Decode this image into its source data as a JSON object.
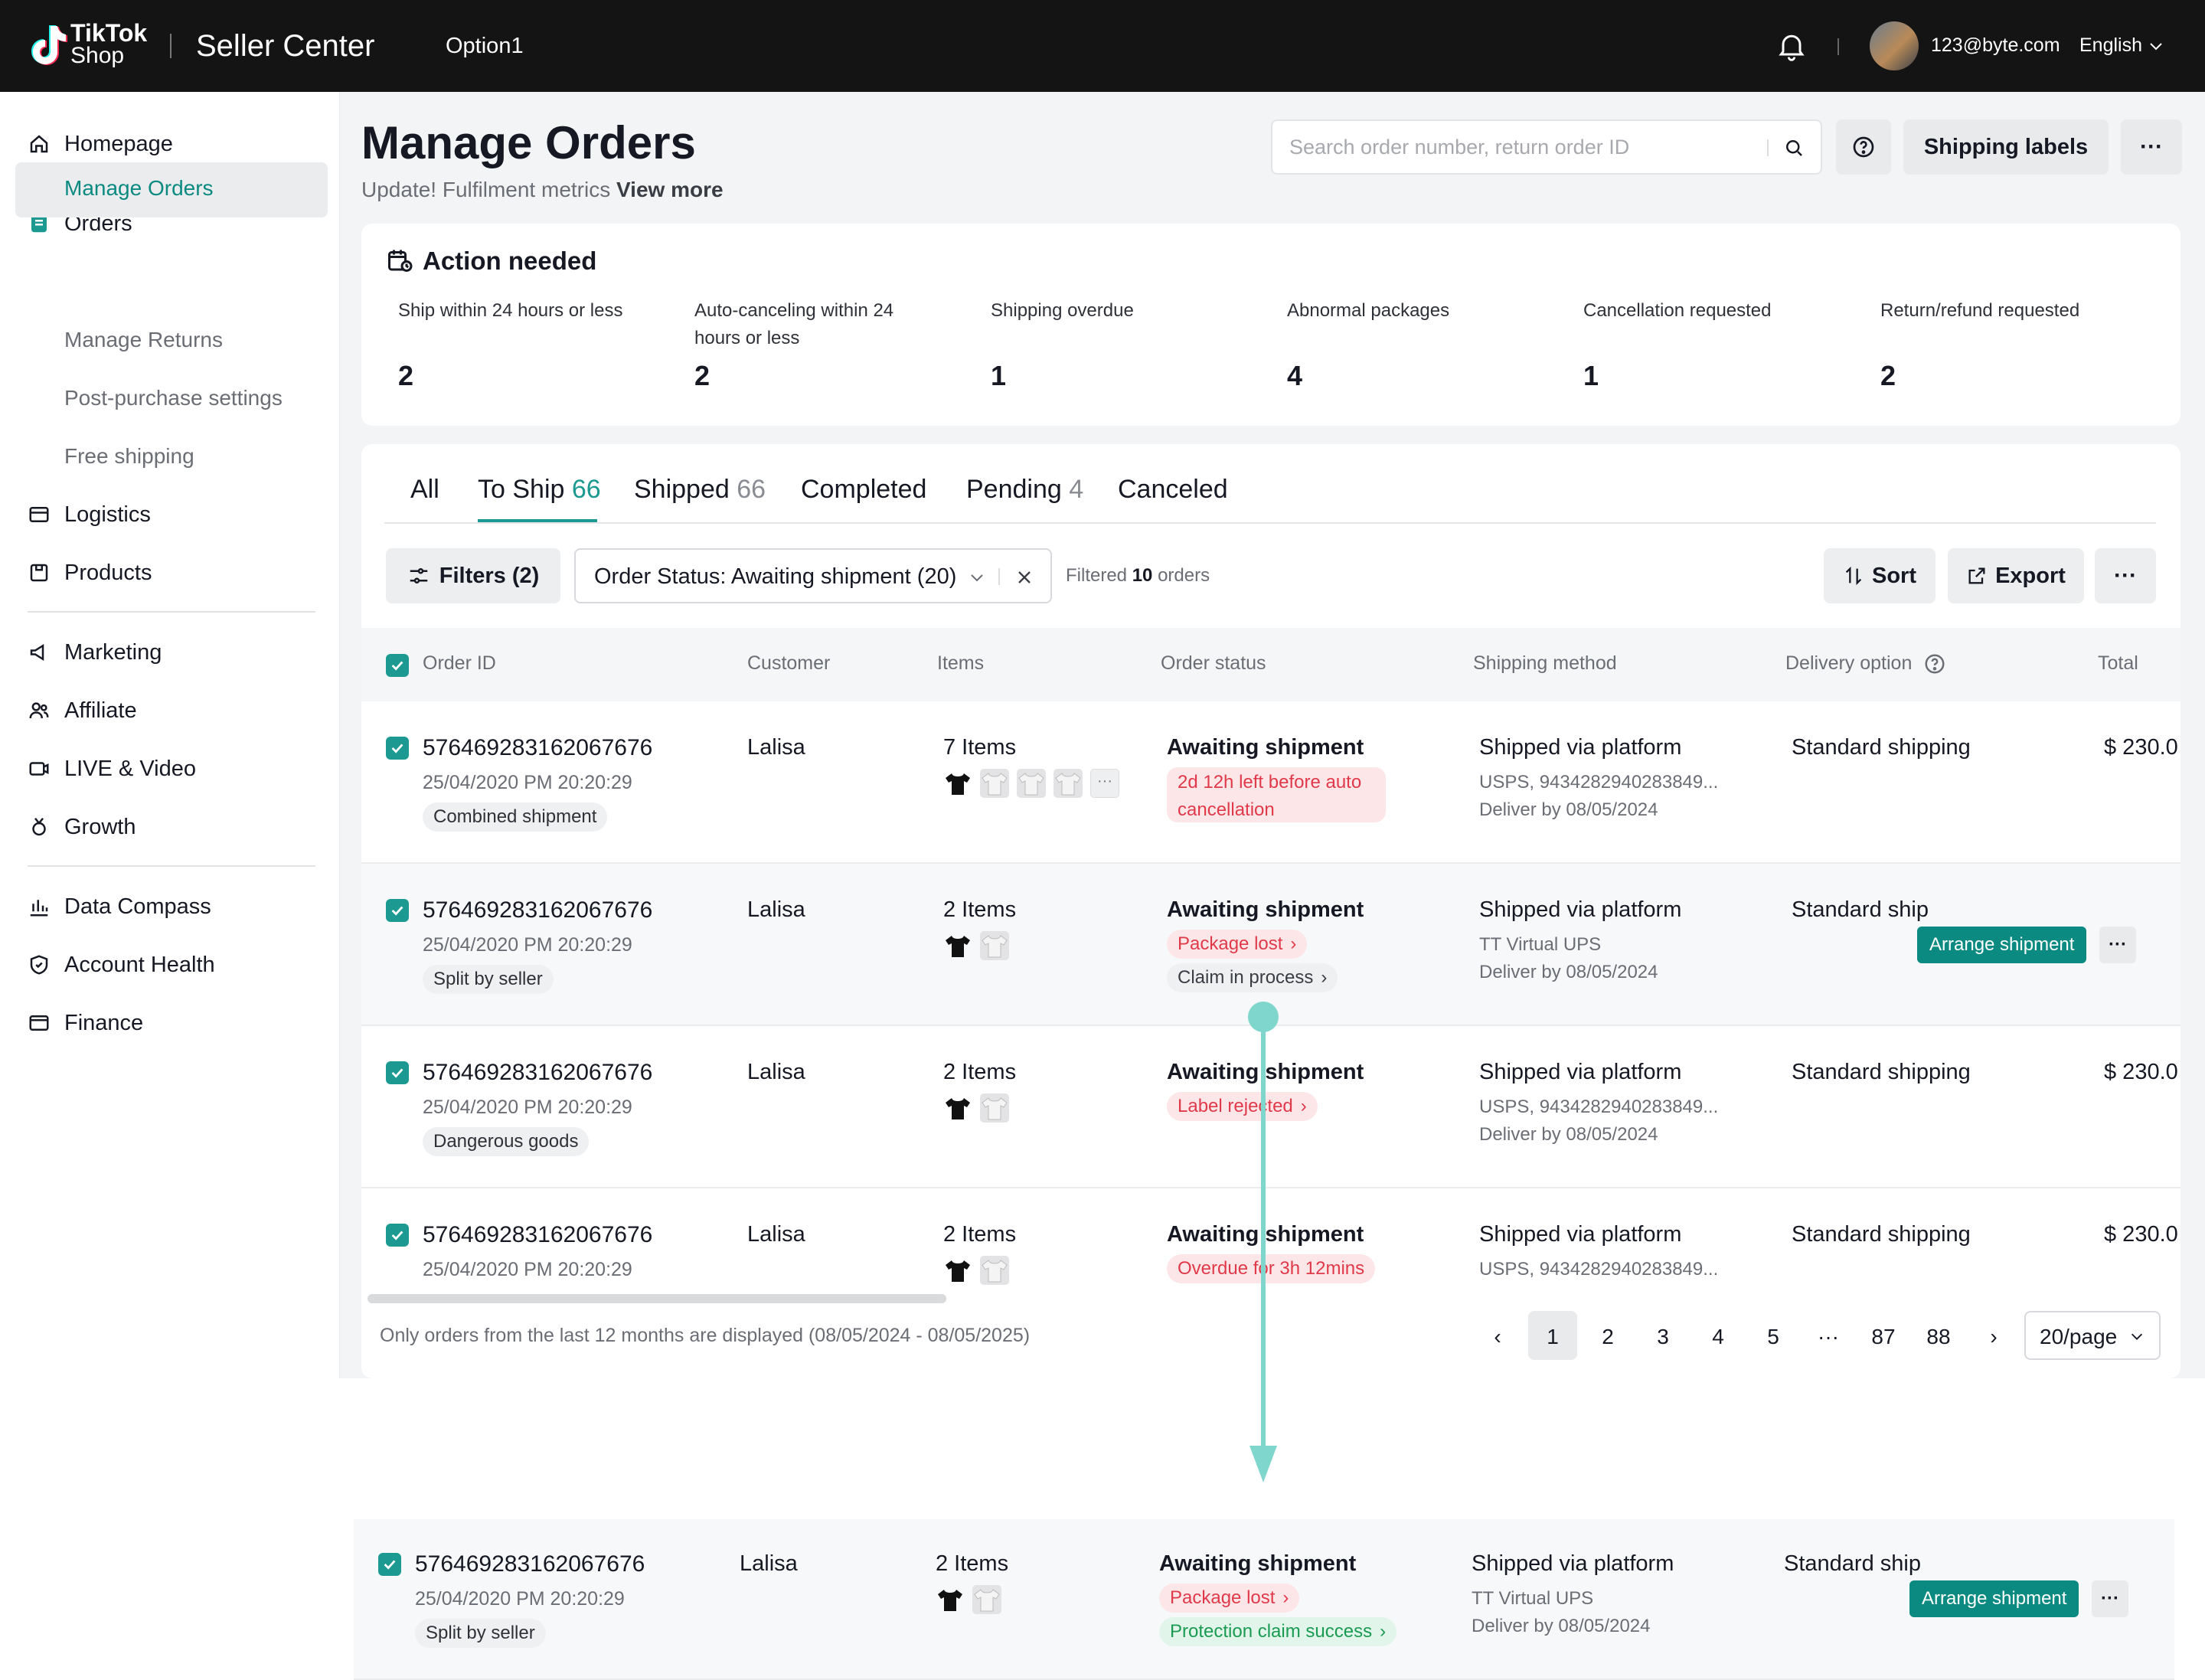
{
  "topbar": {
    "logo_line1": "TikTok",
    "logo_line2": "Shop",
    "app_name": "Seller Center",
    "option": "Option1",
    "email": "123@byte.com",
    "language": "English"
  },
  "sidebar": {
    "homepage": "Homepage",
    "orders": "Orders",
    "manage_orders": "Manage Orders",
    "manage_returns": "Manage Returns",
    "post_purchase": "Post-purchase settings",
    "free_shipping": "Free shipping",
    "logistics": "Logistics",
    "products": "Products",
    "marketing": "Marketing",
    "affiliate": "Affiliate",
    "live_video": "LIVE & Video",
    "growth": "Growth",
    "data_compass": "Data Compass",
    "account_health": "Account Health",
    "finance": "Finance"
  },
  "header": {
    "title": "Manage Orders",
    "subtitle": "Update! Fulfilment metrics",
    "subtitle_link": "View more",
    "search_placeholder": "Search order number, return order ID",
    "shipping_labels": "Shipping labels"
  },
  "action_needed": {
    "title": "Action needed",
    "items": [
      {
        "label": "Ship within 24 hours or less",
        "value": "2"
      },
      {
        "label": "Auto-canceling within 24 hours or less",
        "value": "2"
      },
      {
        "label": "Shipping overdue",
        "value": "1"
      },
      {
        "label": "Abnormal packages",
        "value": "4"
      },
      {
        "label": "Cancellation requested",
        "value": "1"
      },
      {
        "label": "Return/refund requested",
        "value": "2"
      }
    ]
  },
  "tabs": [
    {
      "label": "All",
      "count": ""
    },
    {
      "label": "To Ship",
      "count": "66"
    },
    {
      "label": "Shipped",
      "count": "66"
    },
    {
      "label": "Completed",
      "count": ""
    },
    {
      "label": "Pending",
      "count": "4"
    },
    {
      "label": "Canceled",
      "count": ""
    }
  ],
  "toolbar": {
    "filters": "Filters (2)",
    "status_filter": "Order Status: Awaiting shipment (20)",
    "filtered_prefix": "Filtered",
    "filtered_count": "10",
    "filtered_suffix": "orders",
    "sort": "Sort",
    "export": "Export"
  },
  "table": {
    "columns": [
      "Order ID",
      "Customer",
      "Items",
      "Order status",
      "Shipping method",
      "Delivery option",
      "Total"
    ],
    "rows": [
      {
        "order_id": "576469283162067676",
        "date": "25/04/2020 PM 20:20:29",
        "tag": "Combined shipment",
        "customer": "Lalisa",
        "items": "7 Items",
        "status": "Awaiting shipment",
        "status_pill": "2d 12h left before auto cancellation",
        "shipping": "Shipped via platform",
        "carrier": "USPS, 9434282940283849...",
        "deliver_by": "Deliver by 08/05/2024",
        "delivery": "Standard shipping",
        "total": "$ 230.0"
      },
      {
        "order_id": "576469283162067676",
        "date": "25/04/2020 PM 20:20:29",
        "tag": "Split by seller",
        "customer": "Lalisa",
        "items": "2 Items",
        "status": "Awaiting shipment",
        "status_pill": "Package lost",
        "status_pill2": "Claim in process",
        "shipping": "Shipped via platform",
        "carrier": "TT Virtual UPS",
        "deliver_by": "Deliver by 08/05/2024",
        "delivery": "Standard ship",
        "arrange": "Arrange shipment"
      },
      {
        "order_id": "576469283162067676",
        "date": "25/04/2020 PM 20:20:29",
        "tag": "Dangerous goods",
        "customer": "Lalisa",
        "items": "2 Items",
        "status": "Awaiting shipment",
        "status_pill": "Label rejected",
        "shipping": "Shipped via platform",
        "carrier": "USPS, 9434282940283849...",
        "deliver_by": "Deliver by 08/05/2024",
        "delivery": "Standard shipping",
        "total": "$ 230.0"
      },
      {
        "order_id": "576469283162067676",
        "date": "25/04/2020 PM 20:20:29",
        "customer": "Lalisa",
        "items": "2 Items",
        "status": "Awaiting shipment",
        "status_pill": "Overdue for 3h 12mins",
        "shipping": "Shipped via platform",
        "carrier": "USPS, 9434282940283849...",
        "delivery": "Standard shipping",
        "total": "$ 230.0"
      }
    ]
  },
  "footer": {
    "note": "Only orders from the last 12 months are displayed (08/05/2024 - 08/05/2025)",
    "pages": [
      "1",
      "2",
      "3",
      "4",
      "5",
      "···",
      "87",
      "88"
    ],
    "page_size": "20/page"
  },
  "detail_row": {
    "order_id": "576469283162067676",
    "date": "25/04/2020 PM 20:20:29",
    "tag": "Split by seller",
    "customer": "Lalisa",
    "items": "2 Items",
    "status": "Awaiting shipment",
    "status_pill": "Package lost",
    "status_pill2": "Protection claim success",
    "shipping": "Shipped via platform",
    "carrier": "TT Virtual UPS",
    "deliver_by": "Deliver by 08/05/2024",
    "delivery": "Standard ship",
    "arrange": "Arrange shipment"
  },
  "colors": {
    "accent": "#1c9a92",
    "button_teal": "#0b8a82",
    "danger": "#e03a4a",
    "connector": "#7fd6cd"
  }
}
